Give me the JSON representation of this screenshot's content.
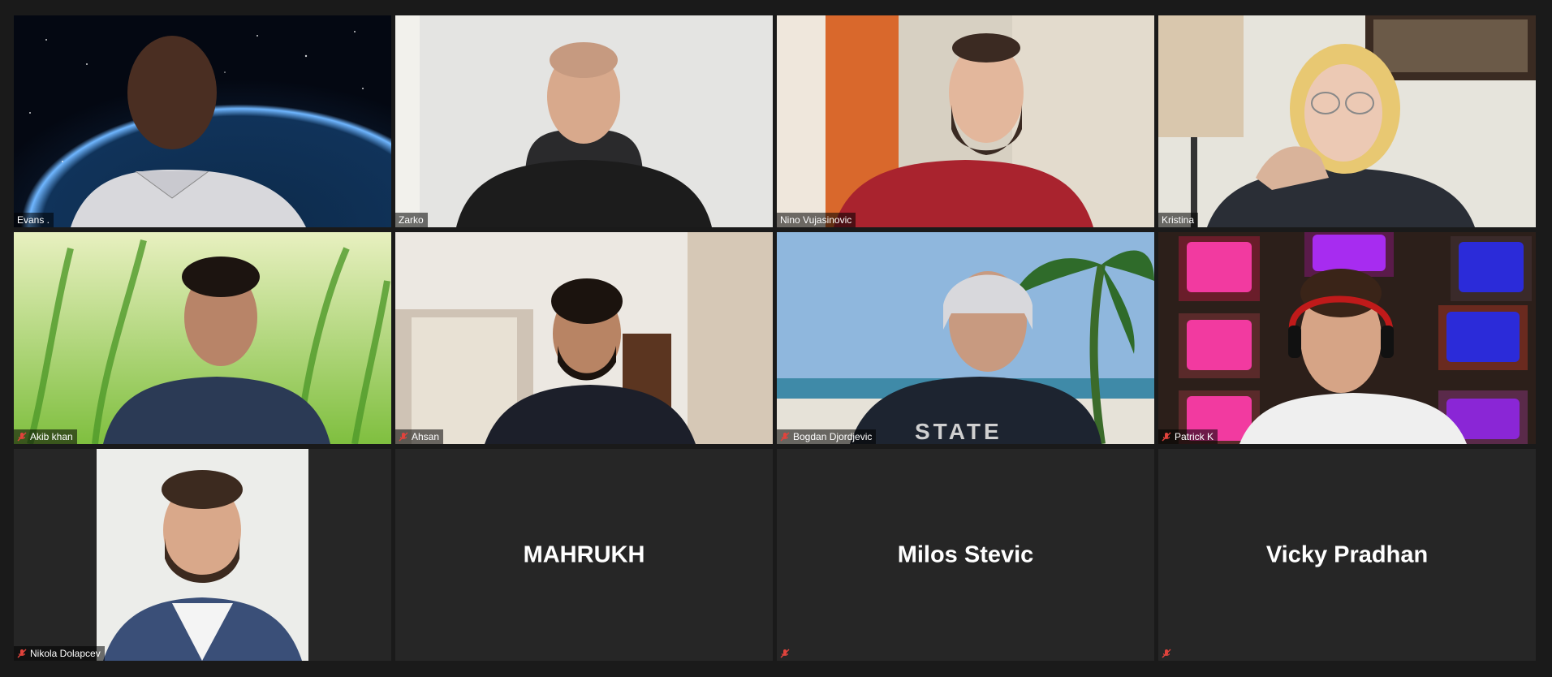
{
  "participants": [
    {
      "name": "Evans .",
      "muted": false,
      "active": true
    },
    {
      "name": "Zarko",
      "muted": false,
      "active": false
    },
    {
      "name": "Nino Vujasinovic",
      "muted": false,
      "active": false
    },
    {
      "name": "Kristina",
      "muted": false,
      "active": false
    },
    {
      "name": "Akib khan",
      "muted": true,
      "active": false
    },
    {
      "name": "Ahsan",
      "muted": true,
      "active": false
    },
    {
      "name": "Bogdan Djordjevic",
      "muted": true,
      "active": false
    },
    {
      "name": "Patrick K",
      "muted": true,
      "active": false
    },
    {
      "name": "Nikola Dolapcev",
      "muted": true,
      "active": false
    },
    {
      "name": "MAHRUKH",
      "muted": false,
      "video_off": true
    },
    {
      "name": "Milos Stevic",
      "muted": true,
      "video_off": true
    },
    {
      "name": "Vicky Pradhan",
      "muted": true,
      "video_off": true
    }
  ],
  "colors": {
    "active_speaker_border": "#d4e35a",
    "mute_icon": "#e0433c",
    "tile_background": "#262626",
    "app_background": "#1a1a1a"
  }
}
